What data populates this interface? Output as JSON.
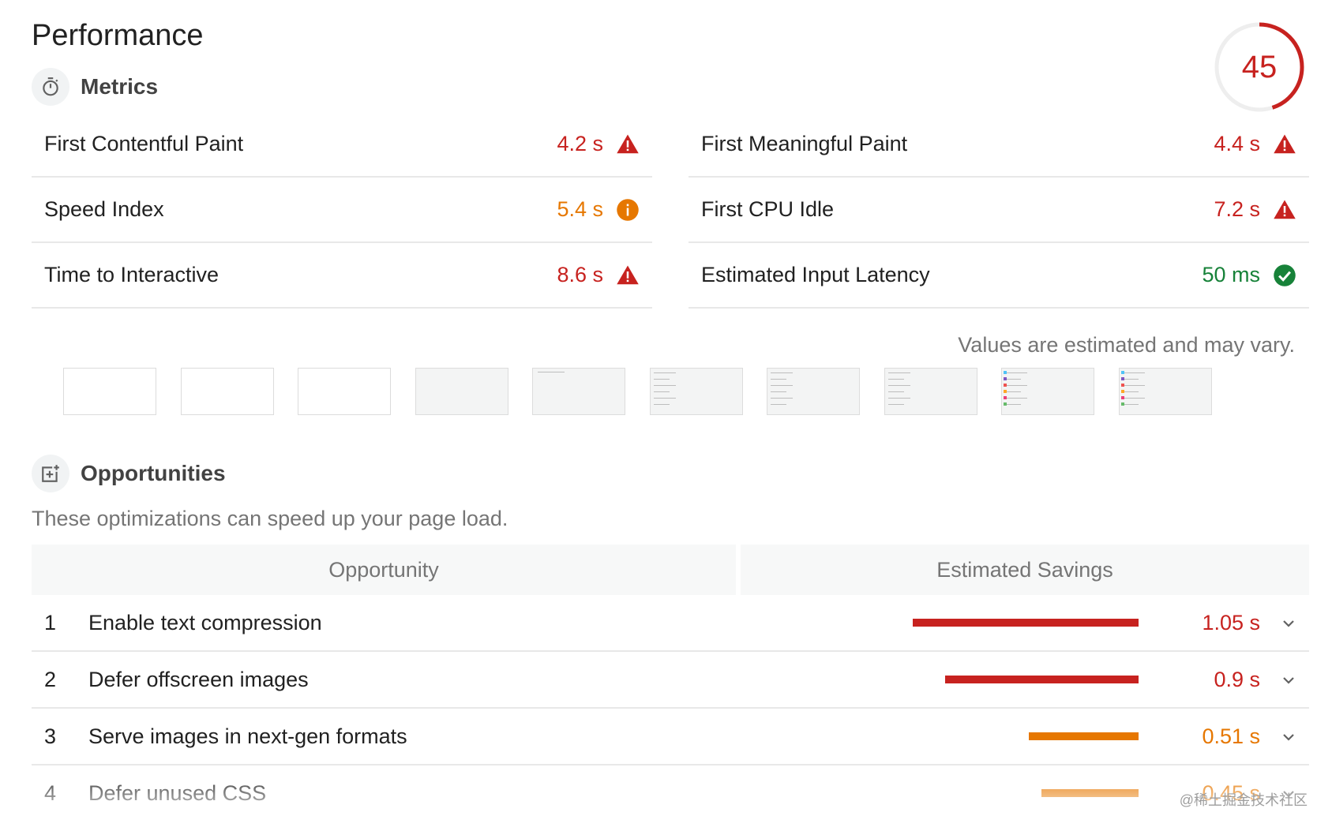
{
  "header": {
    "title": "Performance",
    "score": "45",
    "score_fraction": 0.45,
    "score_color": "#c7221f"
  },
  "metrics": {
    "section_label": "Metrics",
    "section_icon": "stopwatch-icon",
    "left": [
      {
        "name": "First Contentful Paint",
        "value": "4.2 s",
        "status": "fail",
        "icon": "warning-triangle-icon"
      },
      {
        "name": "Speed Index",
        "value": "5.4 s",
        "status": "average",
        "icon": "info-circle-icon"
      },
      {
        "name": "Time to Interactive",
        "value": "8.6 s",
        "status": "fail",
        "icon": "warning-triangle-icon"
      }
    ],
    "right": [
      {
        "name": "First Meaningful Paint",
        "value": "4.4 s",
        "status": "fail",
        "icon": "warning-triangle-icon"
      },
      {
        "name": "First CPU Idle",
        "value": "7.2 s",
        "status": "fail",
        "icon": "warning-triangle-icon"
      },
      {
        "name": "Estimated Input Latency",
        "value": "50 ms",
        "status": "pass",
        "icon": "check-circle-icon"
      }
    ],
    "note": "Values are estimated and may vary."
  },
  "filmstrip": {
    "frames": [
      {
        "state": "blank"
      },
      {
        "state": "blank"
      },
      {
        "state": "blank"
      },
      {
        "state": "gray"
      },
      {
        "state": "header"
      },
      {
        "state": "partial"
      },
      {
        "state": "partial"
      },
      {
        "state": "partial"
      },
      {
        "state": "loaded"
      },
      {
        "state": "loaded"
      }
    ]
  },
  "opportunities": {
    "section_label": "Opportunities",
    "section_icon": "opportunity-icon",
    "description": "These optimizations can speed up your page load.",
    "col_opportunity": "Opportunity",
    "col_savings": "Estimated Savings",
    "rows": [
      {
        "num": "1",
        "name": "Enable text compression",
        "saving": "1.05 s",
        "seconds": 1.05,
        "status": "fail"
      },
      {
        "num": "2",
        "name": "Defer offscreen images",
        "saving": "0.9 s",
        "seconds": 0.9,
        "status": "fail"
      },
      {
        "num": "3",
        "name": "Serve images in next-gen formats",
        "saving": "0.51 s",
        "seconds": 0.51,
        "status": "average"
      },
      {
        "num": "4",
        "name": "Defer unused CSS",
        "saving": "0.45 s",
        "seconds": 0.45,
        "status": "average"
      }
    ],
    "max_seconds": 1.05
  },
  "colors": {
    "fail": "#c7221f",
    "average": "#e67700",
    "pass": "#178239"
  },
  "watermark": "@稀土掘金技术社区"
}
